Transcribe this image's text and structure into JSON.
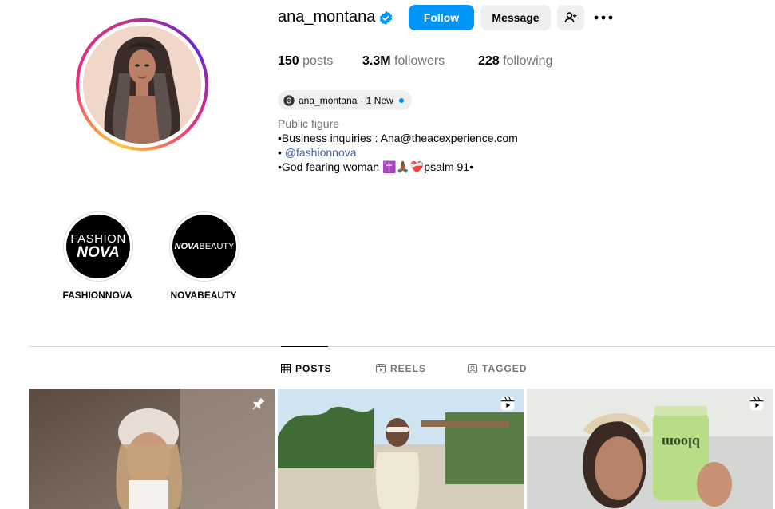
{
  "profile": {
    "username": "ana_montana",
    "follow_label": "Follow",
    "message_label": "Message"
  },
  "stats": {
    "posts_count": "150",
    "posts_label": "posts",
    "followers_count": "3.3M",
    "followers_label": "followers",
    "following_count": "228",
    "following_label": "following"
  },
  "threads": {
    "handle": "ana_montana",
    "badge": "· 1 New"
  },
  "bio": {
    "category": "Public figure",
    "line1": "•Business inquiries : Ana@theacexperience.com",
    "line2_prefix": "• ",
    "line2_link": "@fashionnova",
    "line3_prefix": "•God fearing woman ",
    "line3_emojis": "✝️🙏🏾❤️‍🩹",
    "line3_suffix": "psalm 91•"
  },
  "highlights": [
    {
      "label": "FASHIONNOVA",
      "logo_top": "FASHION",
      "logo_bottom": "NOVA"
    },
    {
      "label": "NOVABEAUTY",
      "logo_bold": "NOVA",
      "logo_thin": "BEAUTY"
    }
  ],
  "tabs": [
    {
      "label": "POSTS",
      "icon": "grid-icon",
      "active": true
    },
    {
      "label": "REELS",
      "icon": "reels-icon",
      "active": false
    },
    {
      "label": "TAGGED",
      "icon": "tagged-icon",
      "active": false
    }
  ],
  "posts": [
    {
      "badge": "pin-icon"
    },
    {
      "badge": "reel-icon"
    },
    {
      "badge": "reel-icon",
      "product_text": "bloom"
    }
  ],
  "colors": {
    "primary_button": "#0095f6",
    "secondary_button": "#efefef",
    "verified": "#0095f6",
    "link": "#4a5eb3",
    "muted_text": "#737373"
  }
}
